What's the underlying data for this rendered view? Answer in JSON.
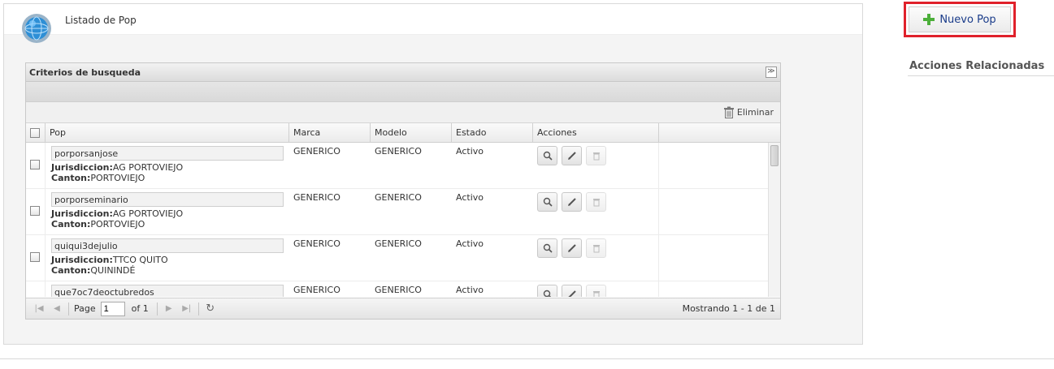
{
  "panel": {
    "title": "Listado de Pop"
  },
  "grid": {
    "title": "Criterios de busqueda",
    "delete_label": "Eliminar",
    "columns": [
      "Pop",
      "Marca",
      "Modelo",
      "Estado",
      "Acciones"
    ],
    "jurisdiction_label": "Jurisdiccion:",
    "canton_label": "Canton:",
    "rows": [
      {
        "pop": "porporsanjose",
        "jurisdiccion": "AG PORTOVIEJO",
        "canton": "PORTOVIEJO",
        "marca": "GENERICO",
        "modelo": "GENERICO",
        "estado": "Activo"
      },
      {
        "pop": "porporseminario",
        "jurisdiccion": "AG PORTOVIEJO",
        "canton": "PORTOVIEJO",
        "marca": "GENERICO",
        "modelo": "GENERICO",
        "estado": "Activo"
      },
      {
        "pop": "quiqui3dejulio",
        "jurisdiccion": "TTCO QUITO",
        "canton": "QUININDÉ",
        "marca": "GENERICO",
        "modelo": "GENERICO",
        "estado": "Activo"
      },
      {
        "pop": "que7oc7deoctubredos",
        "jurisdiccion": "",
        "canton": "",
        "marca": "GENERICO",
        "modelo": "GENERICO",
        "estado": "Activo"
      }
    ],
    "pager": {
      "page_label": "Page",
      "page_value": "1",
      "of_label": "of 1",
      "status": "Mostrando 1 - 1 de 1"
    }
  },
  "sidebar": {
    "new_button_label": "Nuevo Pop",
    "related_title": "Acciones Relacionadas"
  },
  "colors": {
    "highlight_border": "#e0212b",
    "plus_icon": "#4caf3a",
    "link_text": "#1a3c8a"
  }
}
